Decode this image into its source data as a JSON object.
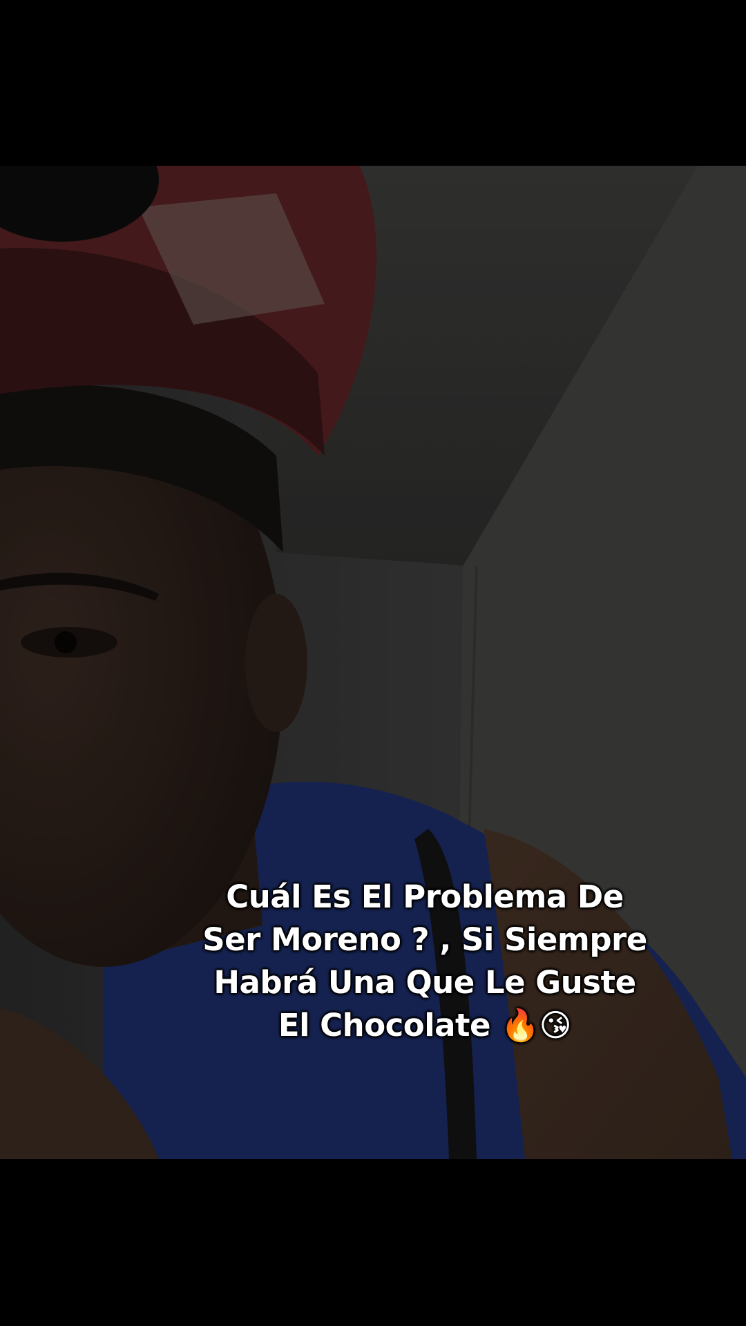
{
  "caption": {
    "line1": "Cuál Es El Problema De",
    "line2": "Ser Moreno ? , Si Siempre",
    "line3": "Habrá Una Que Le Guste",
    "line4": "El Chocolate 🔥😘"
  },
  "colors": {
    "background": "#000000",
    "caption_text": "#ffffff",
    "shirt": "#1c2e6a",
    "cap": "#5a2224"
  }
}
